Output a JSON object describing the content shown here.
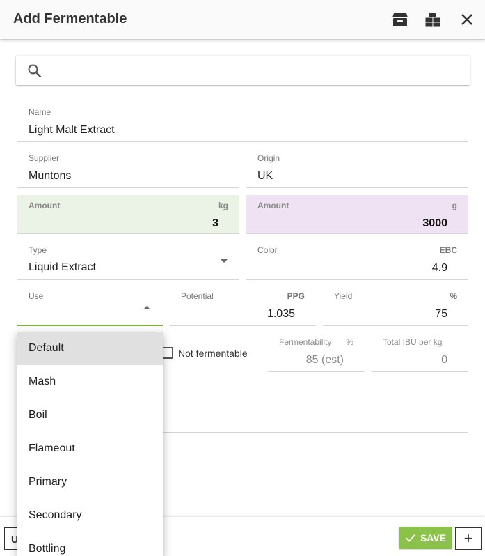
{
  "header": {
    "title": "Add Fermentable"
  },
  "search": {
    "value": "",
    "placeholder": ""
  },
  "form": {
    "name": {
      "label": "Name",
      "value": "Light Malt Extract"
    },
    "supplier": {
      "label": "Supplier",
      "value": "Muntons"
    },
    "origin": {
      "label": "Origin",
      "value": "UK"
    },
    "amount_kg": {
      "label": "Amount",
      "unit": "kg",
      "value": "3"
    },
    "amount_g": {
      "label": "Amount",
      "unit": "g",
      "value": "3000"
    },
    "type": {
      "label": "Type",
      "value": "Liquid Extract"
    },
    "color": {
      "label": "Color",
      "unit": "EBC",
      "value": "4.9"
    },
    "use": {
      "label": "Use",
      "value": ""
    },
    "potential": {
      "label": "Potential",
      "unit": "PPG",
      "value": "1.035"
    },
    "yield": {
      "label": "Yield",
      "unit": "%",
      "value": "75"
    },
    "not_fermentable": {
      "label": "Not fermentable",
      "checked": false
    },
    "fermentability": {
      "label": "Fermentability",
      "unit": "%",
      "value": "85 (est)"
    },
    "total_ibu": {
      "label": "Total IBU per kg",
      "value": "0"
    }
  },
  "use_dropdown": {
    "options": [
      "Default",
      "Mash",
      "Boil",
      "Flameout",
      "Primary",
      "Secondary",
      "Bottling"
    ],
    "selected": "Default"
  },
  "footer": {
    "left_button": "U",
    "save_label": "SAVE",
    "plus_label": "+"
  },
  "colors": {
    "accent": "#8bc34a",
    "amount_kg_bg": "#eaf3e5",
    "amount_g_bg": "#efe3f3"
  }
}
